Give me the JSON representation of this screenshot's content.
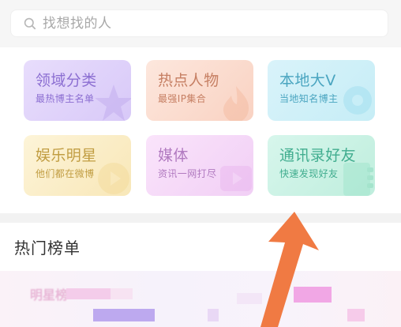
{
  "search": {
    "placeholder": "找想找的人"
  },
  "categories": [
    {
      "title": "领域分类",
      "subtitle": "最热博主名单",
      "icon": "star-icon"
    },
    {
      "title": "热点人物",
      "subtitle": "最强IP集合",
      "icon": "flame-icon"
    },
    {
      "title": "本地大V",
      "subtitle": "当地知名博主",
      "icon": "location-pin-icon"
    },
    {
      "title": "娱乐明星",
      "subtitle": "他们都在微博",
      "icon": "play-icon"
    },
    {
      "title": "媒体",
      "subtitle": "资讯一网打尽",
      "icon": "play-icon"
    },
    {
      "title": "通讯录好友",
      "subtitle": "快速发现好友",
      "icon": "contacts-icon"
    }
  ],
  "rank": {
    "title": "热门榜单",
    "first_item_label": "明星榜"
  },
  "colors": {
    "arrow": "#f07a43"
  }
}
